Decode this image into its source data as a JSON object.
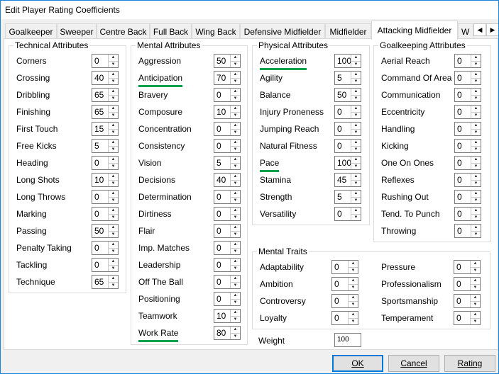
{
  "window": {
    "title": "Edit Player Rating Coefficients"
  },
  "tabs": [
    "Goalkeeper",
    "Sweeper",
    "Centre Back",
    "Full Back",
    "Wing Back",
    "Defensive Midfielder",
    "Midfielder",
    "Attacking Midfielder",
    "W"
  ],
  "active_tab": "Attacking Midfielder",
  "technical": {
    "title": "Technical Attributes",
    "items": [
      {
        "label": "Corners",
        "value": "0"
      },
      {
        "label": "Crossing",
        "value": "40"
      },
      {
        "label": "Dribbling",
        "value": "65"
      },
      {
        "label": "Finishing",
        "value": "65"
      },
      {
        "label": "First Touch",
        "value": "15"
      },
      {
        "label": "Free Kicks",
        "value": "5"
      },
      {
        "label": "Heading",
        "value": "0"
      },
      {
        "label": "Long Shots",
        "value": "10"
      },
      {
        "label": "Long Throws",
        "value": "0"
      },
      {
        "label": "Marking",
        "value": "0"
      },
      {
        "label": "Passing",
        "value": "50"
      },
      {
        "label": "Penalty Taking",
        "value": "0"
      },
      {
        "label": "Tackling",
        "value": "0"
      },
      {
        "label": "Technique",
        "value": "65"
      }
    ]
  },
  "mental": {
    "title": "Mental Attributes",
    "items": [
      {
        "label": "Aggression",
        "value": "50"
      },
      {
        "label": "Anticipation",
        "value": "70"
      },
      {
        "label": "Bravery",
        "value": "0"
      },
      {
        "label": "Composure",
        "value": "10"
      },
      {
        "label": "Concentration",
        "value": "0"
      },
      {
        "label": "Consistency",
        "value": "0"
      },
      {
        "label": "Vision",
        "value": "5"
      },
      {
        "label": "Decisions",
        "value": "40"
      },
      {
        "label": "Determination",
        "value": "0"
      },
      {
        "label": "Dirtiness",
        "value": "0"
      },
      {
        "label": "Flair",
        "value": "0"
      },
      {
        "label": "Imp. Matches",
        "value": "0"
      },
      {
        "label": "Leadership",
        "value": "0"
      },
      {
        "label": "Off The Ball",
        "value": "0"
      },
      {
        "label": "Positioning",
        "value": "0"
      },
      {
        "label": "Teamwork",
        "value": "10"
      },
      {
        "label": "Work Rate",
        "value": "80"
      }
    ]
  },
  "physical": {
    "title": "Physical Attributes",
    "items": [
      {
        "label": "Acceleration",
        "value": "100"
      },
      {
        "label": "Agility",
        "value": "5"
      },
      {
        "label": "Balance",
        "value": "50"
      },
      {
        "label": "Injury Proneness",
        "value": "0"
      },
      {
        "label": "Jumping Reach",
        "value": "0"
      },
      {
        "label": "Natural Fitness",
        "value": "0"
      },
      {
        "label": "Pace",
        "value": "100"
      },
      {
        "label": "Stamina",
        "value": "45"
      },
      {
        "label": "Strength",
        "value": "5"
      },
      {
        "label": "Versatility",
        "value": "0"
      }
    ]
  },
  "goalkeeping": {
    "title": "Goalkeeping Attributes",
    "items": [
      {
        "label": "Aerial Reach",
        "value": "0"
      },
      {
        "label": "Command Of Area",
        "value": "0"
      },
      {
        "label": "Communication",
        "value": "0"
      },
      {
        "label": "Eccentricity",
        "value": "0"
      },
      {
        "label": "Handling",
        "value": "0"
      },
      {
        "label": "Kicking",
        "value": "0"
      },
      {
        "label": "One On Ones",
        "value": "0"
      },
      {
        "label": "Reflexes",
        "value": "0"
      },
      {
        "label": "Rushing Out",
        "value": "0"
      },
      {
        "label": "Tend. To Punch",
        "value": "0"
      },
      {
        "label": "Throwing",
        "value": "0"
      }
    ]
  },
  "traits": {
    "title": "Mental Traits",
    "left": [
      {
        "label": "Adaptability",
        "value": "0"
      },
      {
        "label": "Ambition",
        "value": "0"
      },
      {
        "label": "Controversy",
        "value": "0"
      },
      {
        "label": "Loyalty",
        "value": "0"
      }
    ],
    "right": [
      {
        "label": "Pressure",
        "value": "0"
      },
      {
        "label": "Professionalism",
        "value": "0"
      },
      {
        "label": "Sportsmanship",
        "value": "0"
      },
      {
        "label": "Temperament",
        "value": "0"
      }
    ]
  },
  "weight": {
    "label": "Weight",
    "value": "100"
  },
  "buttons": {
    "ok": "OK",
    "cancel": "Cancel",
    "rating": "Rating"
  },
  "highlighted": [
    "Anticipation",
    "Work Rate",
    "Acceleration",
    "Pace"
  ],
  "colors": {
    "highlight": "#00a14b",
    "accent": "#0078d7"
  }
}
